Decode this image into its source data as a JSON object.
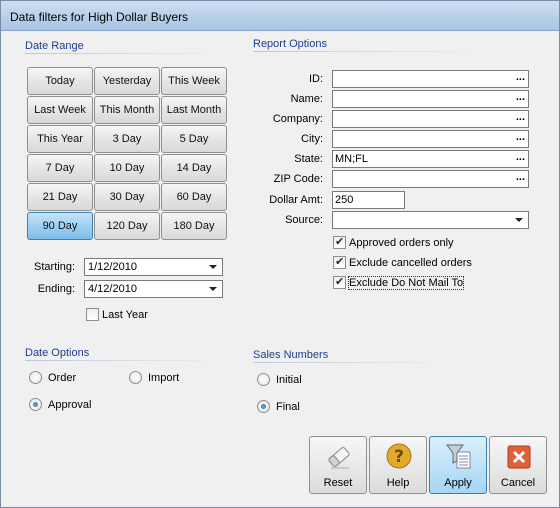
{
  "window": {
    "title": "Data filters for High Dollar Buyers"
  },
  "date_range": {
    "label": "Date Range",
    "buttons": [
      "Today",
      "Yesterday",
      "This Week",
      "Last Week",
      "This Month",
      "Last Month",
      "This Year",
      "3 Day",
      "5 Day",
      "7 Day",
      "10 Day",
      "14 Day",
      "21 Day",
      "30 Day",
      "60 Day",
      "90 Day",
      "120 Day",
      "180 Day"
    ],
    "selected": "90 Day",
    "starting_label": "Starting:",
    "starting_value": "1/12/2010",
    "ending_label": "Ending:",
    "ending_value": "4/12/2010",
    "last_year_label": "Last Year",
    "last_year_checked": false
  },
  "report_options": {
    "label": "Report Options",
    "id_label": "ID:",
    "id_value": "",
    "name_label": "Name:",
    "name_value": "",
    "company_label": "Company:",
    "company_value": "",
    "city_label": "City:",
    "city_value": "",
    "state_label": "State:",
    "state_value": "MN;FL",
    "zip_label": "ZIP Code:",
    "zip_value": "",
    "dollar_label": "Dollar Amt:",
    "dollar_value": "250",
    "source_label": "Source:",
    "source_value": "",
    "ellipsis": "...",
    "approved_label": "Approved orders only",
    "cancelled_label": "Exclude cancelled orders",
    "donotmail_label": "Exclude Do Not Mail To"
  },
  "date_options": {
    "label": "Date Options",
    "order": "Order",
    "import": "Import",
    "approval": "Approval",
    "selected": "Approval"
  },
  "sales_numbers": {
    "label": "Sales Numbers",
    "initial": "Initial",
    "final": "Final",
    "selected": "Final"
  },
  "actions": {
    "reset": "Reset",
    "help": "Help",
    "apply": "Apply",
    "cancel": "Cancel"
  },
  "colors": {
    "accent": "#1e3d8f",
    "selected_button": "#9dd0f3",
    "cancel_icon": "#e0603a",
    "help_icon": "#e2a92c"
  }
}
